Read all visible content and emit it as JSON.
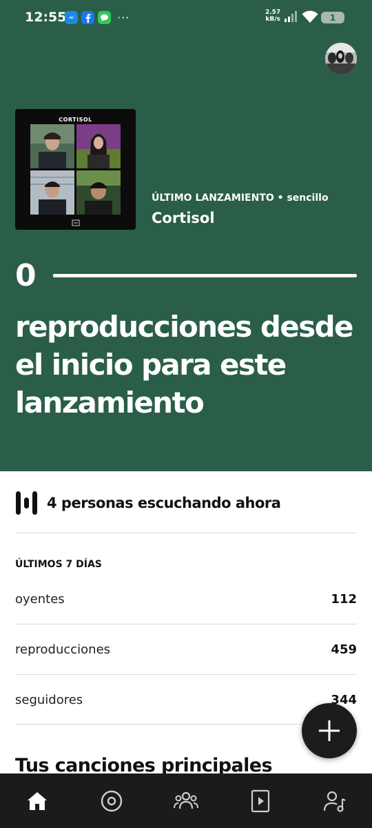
{
  "status_bar": {
    "time": "12:55",
    "net_speed_value": "2.57",
    "net_speed_unit": "kB/s",
    "battery": "1",
    "notification_icons": [
      "messenger-icon",
      "facebook-icon",
      "messages-icon"
    ],
    "overflow": "···"
  },
  "hero": {
    "background": "#2a5e48",
    "cover_title": "CORTISOL",
    "release_kicker": "ÚLTIMO LANZAMIENTO • sencillo",
    "release_name": "Cortisol",
    "streams_count": "0",
    "streams_caption": "reproducciones desde el inicio para este lanzamiento"
  },
  "live": {
    "text": "4 personas escuchando ahora"
  },
  "stats": {
    "section_title": "ÚLTIMOS 7 DÍAS",
    "rows": [
      {
        "label": "oyentes",
        "value": "112"
      },
      {
        "label": "reproducciones",
        "value": "459"
      },
      {
        "label": "seguidores",
        "value": "344"
      }
    ]
  },
  "top_songs_title": "Tus canciones principales",
  "fab_icon": "plus-icon",
  "nav": {
    "items": [
      "home-icon",
      "music-icon",
      "audience-icon",
      "video-icon",
      "artist-profile-icon"
    ]
  }
}
